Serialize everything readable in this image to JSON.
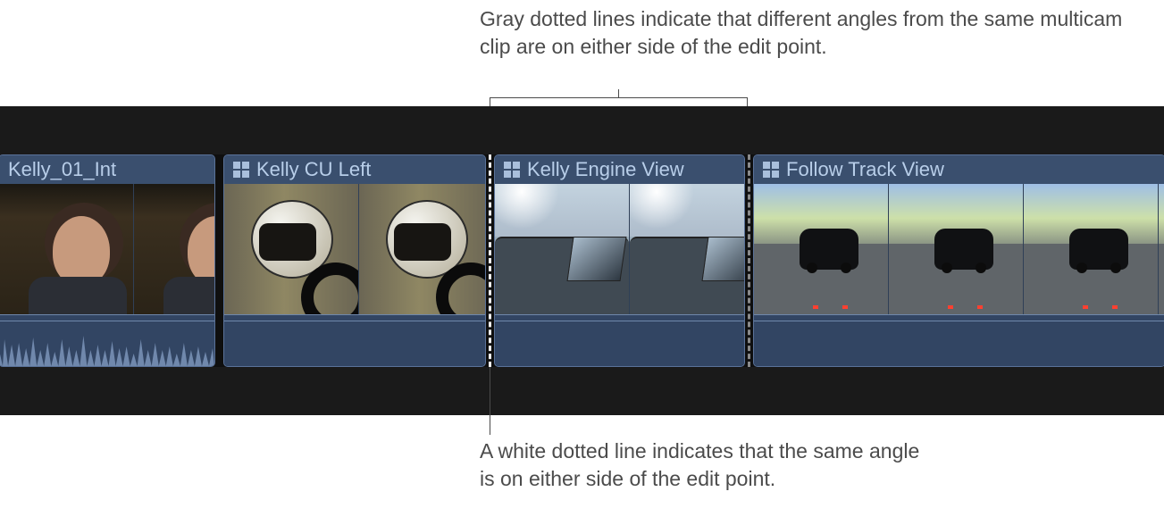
{
  "annotations": {
    "top": "Gray dotted lines indicate that different angles from the same multicam clip are on either side of the edit point.",
    "bottom": "A white dotted line indicates that the same angle is on either side of the edit point."
  },
  "clips": [
    {
      "label": "Kelly_01_Int",
      "has_multicam_icon": false
    },
    {
      "label": "Kelly CU Left",
      "has_multicam_icon": true
    },
    {
      "label": "Kelly Engine View",
      "has_multicam_icon": true
    },
    {
      "label": "Follow Track View",
      "has_multicam_icon": true
    }
  ],
  "edit_lines": [
    {
      "kind": "white-dotted",
      "meaning": "same angle on either side"
    },
    {
      "kind": "gray-dotted",
      "meaning": "different angles on either side"
    }
  ],
  "colors": {
    "clip_fill": "#304057",
    "clip_header": "#3a4f6e",
    "label_text": "#b8cee9",
    "timeline_bg": "#1a1a1a"
  }
}
